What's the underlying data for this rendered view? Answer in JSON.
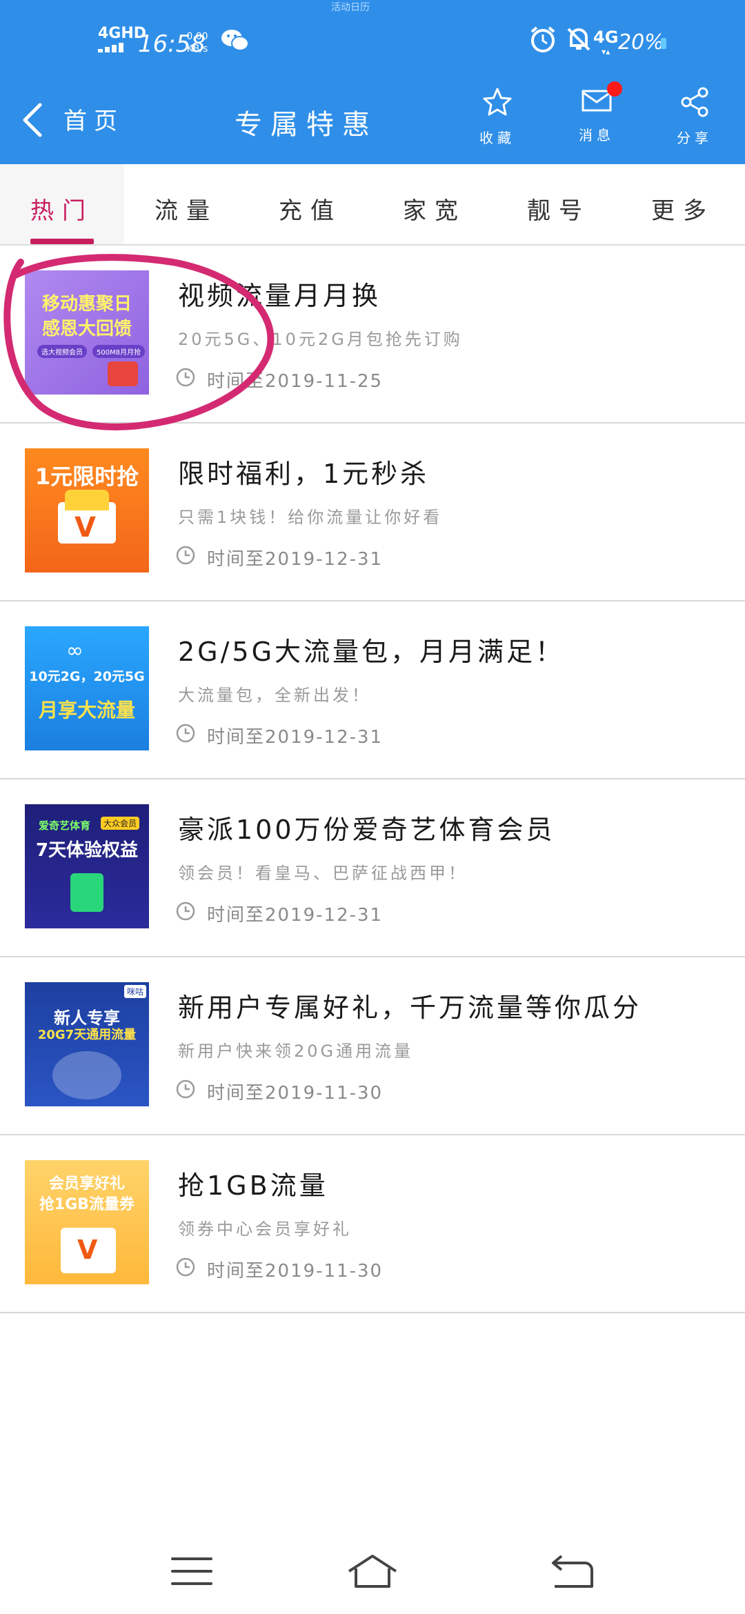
{
  "status_bar": {
    "network": "4GHD",
    "time": "16:58",
    "speed_value": "0.00",
    "speed_unit": "KB/s",
    "signal": "4G",
    "battery": "20%",
    "carrier_hint": "活动日历"
  },
  "header": {
    "back_label": "首页",
    "title": "专属特惠",
    "favorite_label": "收藏",
    "message_label": "消息",
    "share_label": "分享"
  },
  "tabs": [
    {
      "label": "热门"
    },
    {
      "label": "流量"
    },
    {
      "label": "充值"
    },
    {
      "label": "家宽"
    },
    {
      "label": "靓号"
    },
    {
      "label": "更多"
    }
  ],
  "offers": [
    {
      "title": "视频流量月月换",
      "subtitle": "20元5G、10元2G月包抢先订购",
      "date": "时间至2019-11-25",
      "thumb_text_1": "移动惠聚日",
      "thumb_text_2": "感恩大回馈",
      "thumb_tag_1": "选大视频会员",
      "thumb_tag_2": "500M8月月抢"
    },
    {
      "title": "限时福利，1元秒杀",
      "subtitle": "只需1块钱！给你流量让你好看",
      "date": "时间至2019-12-31",
      "thumb_text_1": "1元限时抢"
    },
    {
      "title": "2G/5G大流量包，月月满足！",
      "subtitle": "大流量包，全新出发！",
      "date": "时间至2019-12-31",
      "thumb_text_1": "10元2G，20元5G",
      "thumb_text_2": "月享大流量"
    },
    {
      "title": "豪派100万份爱奇艺体育会员",
      "subtitle": "领会员！看皇马、巴萨征战西甲！",
      "date": "时间至2019-12-31",
      "thumb_text_1": "爱奇艺体育",
      "thumb_tag_1": "大众会员",
      "thumb_text_2": "7天体验权益"
    },
    {
      "title": "新用户专属好礼，千万流量等你瓜分",
      "subtitle": "新用户快来领20G通用流量",
      "date": "时间至2019-11-30",
      "thumb_text_1": "新人专享",
      "thumb_text_2": "20G7天通用流量",
      "thumb_tag_1": "咪咕"
    },
    {
      "title": "抢1GB流量",
      "subtitle": "领券中心会员享好礼",
      "date": "时间至2019-11-30",
      "thumb_text_1": "会员享好礼",
      "thumb_text_2": "抢1GB流量券"
    }
  ],
  "colors": {
    "header_blue": "#2f8fe8",
    "accent_pink": "#c81e5f",
    "badge_red": "#ff1a1a"
  }
}
